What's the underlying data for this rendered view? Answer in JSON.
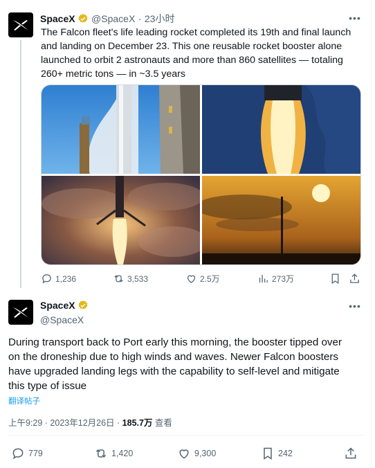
{
  "colors": {
    "accent": "#1d9bf0",
    "muted": "#536471",
    "verified": "#e2b719",
    "text": "#0f1419"
  },
  "quoted": {
    "name": "SpaceX",
    "handle": "@SpaceX",
    "time": "23小时",
    "text_lines": [
      "The Falcon fleet's life leading rocket completed its 19th and final launch",
      "and landing on December 23. This one reusable rocket booster alone",
      "launched to orbit 2 astronauts and more than 860 satellites — totaling",
      "260+ metric tons — in ~3.5 years"
    ],
    "media": [
      "rocket-on-pad-photo",
      "booster-engine-plume-photo",
      "booster-landing-photo",
      "rocket-at-sunset-photo"
    ],
    "actions": {
      "replies": "1,236",
      "reposts": "3,533",
      "likes": "2.5万",
      "views": "273万"
    }
  },
  "main": {
    "name": "SpaceX",
    "handle": "@SpaceX",
    "text_lines": [
      "During transport back to Port early this morning, the booster tipped over",
      "on the droneship due to high winds and waves. Newer Falcon boosters",
      "have upgraded landing legs with the capability to self-level and mitigate",
      "this type of issue"
    ],
    "translate": "翻译帖子",
    "timestamp": "上午9:29 · 2023年12月26日 · ",
    "views_count": "185.7万",
    "views_label": " 查看",
    "actions": {
      "replies": "779",
      "reposts": "1,420",
      "likes": "9,300",
      "bookmarks": "242"
    }
  }
}
